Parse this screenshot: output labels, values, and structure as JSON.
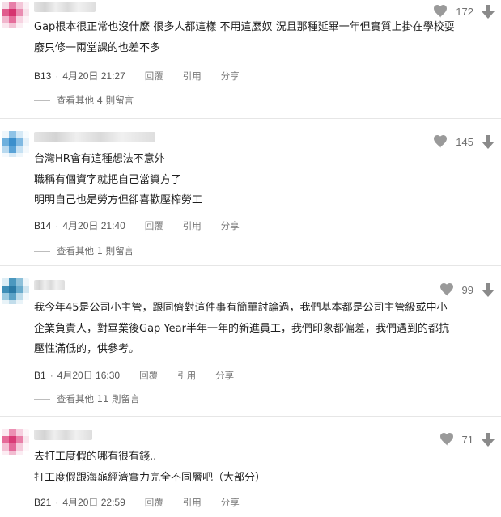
{
  "colors": {
    "text": "#1f1f1f",
    "meta": "#6f6f6f",
    "icon": "#9a9a9a",
    "divider": "#e6e6e6"
  },
  "comments": [
    {
      "likes": "172",
      "lines": [
        "Gap根本很正常也沒什麼 很多人都這樣 不用這麼奴 況且那種延畢一年但實質上掛在學校耍",
        "廢只修一兩堂課的也差不多"
      ],
      "floor": "B13",
      "datetime": "4月20日 21:27",
      "reply_label": "回覆",
      "quote_label": "引用",
      "share_label": "分享",
      "more_replies": "查看其他 4 則留言"
    },
    {
      "likes": "145",
      "lines": [
        "台灣HR會有這種想法不意外",
        "職稱有個資字就把自己當資方了",
        "明明自己也是勞方但卻喜歡壓榨勞工"
      ],
      "floor": "B14",
      "datetime": "4月20日 21:40",
      "reply_label": "回覆",
      "quote_label": "引用",
      "share_label": "分享",
      "more_replies": "查看其他 1 則留言"
    },
    {
      "likes": "99",
      "lines": [
        "我今年45是公司小主管，跟同儕對這件事有簡單討論過，我們基本都是公司主管級或中小",
        "企業負責人，對畢業後Gap Year半年一年的新進員工，我們印象都偏差，我們遇到的都抗",
        "壓性滿低的，供參考。"
      ],
      "floor": "B1",
      "datetime": "4月20日 16:30",
      "reply_label": "回覆",
      "quote_label": "引用",
      "share_label": "分享",
      "more_replies": "查看其他 11 則留言"
    },
    {
      "likes": "71",
      "lines": [
        "去打工度假的哪有很有錢..",
        "打工度假跟海龜經濟實力完全不同層吧（大部分）"
      ],
      "floor": "B21",
      "datetime": "4月20日 22:59",
      "reply_label": "回覆",
      "quote_label": "引用",
      "share_label": "分享"
    }
  ]
}
